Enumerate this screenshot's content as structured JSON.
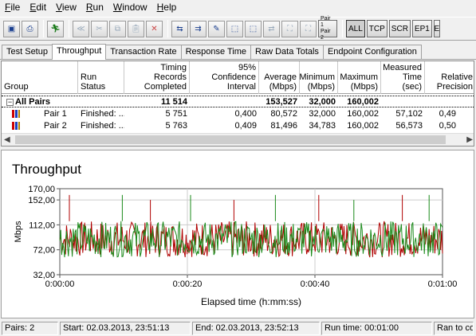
{
  "menu": [
    {
      "u": "F",
      "rest": "ile"
    },
    {
      "u": "E",
      "rest": "dit"
    },
    {
      "u": "V",
      "rest": "iew"
    },
    {
      "u": "R",
      "rest": "un"
    },
    {
      "u": "W",
      "rest": "indow"
    },
    {
      "u": "H",
      "rest": "elp"
    }
  ],
  "toolbar": {
    "pair_label_1": "Pair 1",
    "pair_label_2": "Pair 2",
    "all": "ALL",
    "tcp": "TCP",
    "scr": "SCR",
    "ep1": "EP1",
    "ep_cut": "E"
  },
  "tabs": [
    "Test Setup",
    "Throughput",
    "Transaction Rate",
    "Response Time",
    "Raw Data Totals",
    "Endpoint Configuration"
  ],
  "active_tab": 1,
  "grid": {
    "headers": [
      "Group",
      "Run Status",
      "Timing Records\nCompleted",
      "95% Confidence\nInterval",
      "Average\n(Mbps)",
      "Minimum\n(Mbps)",
      "Maximum\n(Mbps)",
      "Measured\nTime (sec)",
      "Relative\nPrecision"
    ],
    "all_pairs": {
      "expander": "−",
      "label": "All Pairs",
      "records": "11 514",
      "average": "153,527",
      "minimum": "32,000",
      "maximum": "160,002"
    },
    "rows": [
      {
        "group": "Pair 1",
        "status": "Finished: ...",
        "records": "5 751",
        "ci": "0,400",
        "average": "80,572",
        "minimum": "32,000",
        "maximum": "160,002",
        "time": "57,102",
        "precision": "0,49"
      },
      {
        "group": "Pair 2",
        "status": "Finished: ...",
        "records": "5 763",
        "ci": "0,409",
        "average": "81,496",
        "minimum": "34,783",
        "maximum": "160,002",
        "time": "56,573",
        "precision": "0,50"
      }
    ],
    "scroll_left": "◀",
    "scroll_right": "▶"
  },
  "chart_title": "Throughput",
  "chart_data": {
    "type": "line",
    "title": "Throughput",
    "xlabel": "Elapsed time (h:mm:ss)",
    "ylabel": "Mbps",
    "xlim": [
      0,
      60
    ],
    "ylim": [
      32,
      170
    ],
    "x_ticks": [
      0,
      20,
      40,
      60
    ],
    "x_tick_labels": [
      "0:00:00",
      "0:00:20",
      "0:00:40",
      "0:01:00"
    ],
    "y_ticks": [
      32,
      72,
      112,
      152,
      170
    ],
    "y_tick_labels": [
      "32,00",
      "72,00",
      "112,00",
      "152,00",
      "170,00"
    ],
    "grid": true,
    "series": [
      {
        "name": "Pair 1",
        "color": "#b00000",
        "band_low": 60,
        "band_high": 118,
        "mean": 80.572
      },
      {
        "name": "Pair 2",
        "color": "#1a8a1a",
        "band_low": 60,
        "band_high": 118,
        "mean": 81.496
      }
    ],
    "spikes": [
      {
        "x": 1.5,
        "y": 160
      },
      {
        "x": 9.8,
        "y": 160
      },
      {
        "x": 14.2,
        "y": 152
      },
      {
        "x": 20.5,
        "y": 160
      },
      {
        "x": 27.3,
        "y": 152
      },
      {
        "x": 33.8,
        "y": 160
      },
      {
        "x": 40.6,
        "y": 160
      },
      {
        "x": 46.1,
        "y": 152
      },
      {
        "x": 53.7,
        "y": 160
      },
      {
        "x": 57.9,
        "y": 160
      }
    ]
  },
  "status": {
    "pairs": "Pairs: 2",
    "start": "Start: 02.03.2013, 23:51:13",
    "end": "End: 02.03.2013, 23:52:13",
    "runtime": "Run time: 00:01:00",
    "ran": "Ran to co"
  }
}
